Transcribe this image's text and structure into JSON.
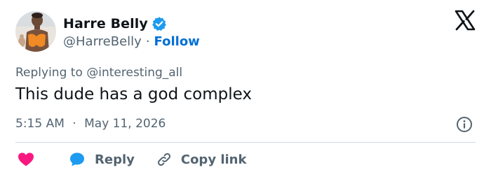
{
  "author": {
    "display_name": "Harre Belly",
    "handle": "@HarreBelly",
    "separator": "·",
    "follow_label": "Follow",
    "verified": true
  },
  "reply_context": {
    "prefix": "Replying to",
    "mention": "@interesting_all"
  },
  "tweet": {
    "text": "This dude has a god complex",
    "time": "5:15 AM",
    "separator": "·",
    "date": "May 11, 2026"
  },
  "actions": {
    "reply_label": "Reply",
    "copy_link_label": "Copy link"
  },
  "icons": {
    "logo": "x-logo-icon",
    "verified": "verified-badge-icon",
    "info": "info-icon",
    "like": "heart-icon",
    "reply": "speech-bubble-icon",
    "copy_link": "link-icon"
  },
  "colors": {
    "text": "#0f1419",
    "secondary": "#536471",
    "link_blue": "#006fd6",
    "verified_blue": "#1d9bf0",
    "heart_pink": "#f91880",
    "divider": "#cfd9de"
  }
}
